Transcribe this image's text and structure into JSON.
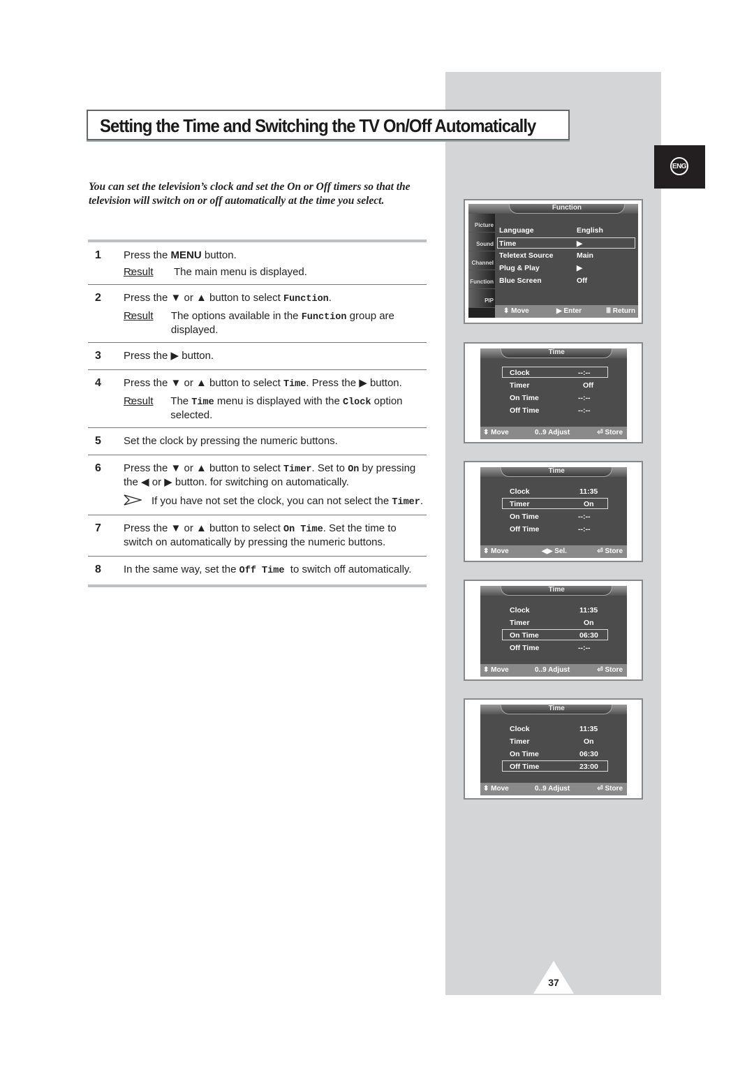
{
  "header": {
    "title": "Setting the Time and Switching the TV On/Off Automatically",
    "language_badge": "ENG"
  },
  "intro": "You can set the television’s clock and set the On or Off timers so that the television will switch on or off automatically at the time you select.",
  "steps": [
    {
      "num": "1",
      "parts": [
        "Press the ",
        "MENU",
        " button."
      ],
      "result_label": "Result",
      "result": "The main menu is displayed."
    },
    {
      "num": "2",
      "parts": [
        "Press the ▼ or ▲ button to select ",
        "Function",
        "."
      ],
      "result_label": "Result",
      "result_parts": [
        "The options available in the ",
        "Function",
        " group are displayed."
      ]
    },
    {
      "num": "3",
      "text": "Press the ▶ button."
    },
    {
      "num": "4",
      "parts": [
        "Press the ▼ or ▲ button to select ",
        "Time",
        ". Press the ▶ button."
      ],
      "result_label": "Result",
      "result_parts": [
        "The ",
        "Time",
        " menu is displayed with the ",
        "Clock",
        " option selected."
      ]
    },
    {
      "num": "5",
      "text": "Set the clock by pressing the numeric buttons."
    },
    {
      "num": "6",
      "parts": [
        "Press the ▼ or ▲ button to select ",
        "Timer",
        ". Set to ",
        "On",
        " by pressing the ◀ or ▶ button. for switching on automatically."
      ],
      "note_parts": [
        "If you have not set the clock, you can not select the ",
        "Timer",
        "."
      ]
    },
    {
      "num": "7",
      "parts": [
        "Press the ▼ or ▲ button to select ",
        "On Time",
        ". Set the time to switch on automatically by pressing the numeric buttons."
      ]
    },
    {
      "num": "8",
      "parts": [
        "In the same way, set the ",
        "Off Time",
        "  to switch off automatically."
      ]
    }
  ],
  "screens": {
    "function_menu": {
      "title": "Function",
      "side_tabs": [
        "Picture",
        "Sound",
        "Channel",
        "Function",
        "PIP"
      ],
      "rows": [
        {
          "label": "Language",
          "value": "English"
        },
        {
          "label": "Time",
          "value": "▶",
          "selected": true
        },
        {
          "label": "Teletext Source",
          "value": "Main"
        },
        {
          "label": "Plug & Play",
          "value": "▶"
        },
        {
          "label": "Blue Screen",
          "value": "Off"
        }
      ],
      "footer": {
        "move": "⬍ Move",
        "enter": "▶ Enter",
        "return": "Ⅲ Return"
      }
    },
    "time_1": {
      "title": "Time",
      "rows": [
        {
          "label": "Clock",
          "value": "--:--",
          "selected": true
        },
        {
          "label": "Timer",
          "value": "Off"
        },
        {
          "label": "On Time",
          "value": "--:--"
        },
        {
          "label": "Off Time",
          "value": "--:--"
        }
      ],
      "footer": {
        "move": "⬍ Move",
        "mid": "0..9 Adjust",
        "store": "⏎ Store"
      }
    },
    "time_2": {
      "title": "Time",
      "rows": [
        {
          "label": "Clock",
          "value": "11:35"
        },
        {
          "label": "Timer",
          "value": "On",
          "selected": true
        },
        {
          "label": "On Time",
          "value": "--:--"
        },
        {
          "label": "Off Time",
          "value": "--:--"
        }
      ],
      "footer": {
        "move": "⬍ Move",
        "mid": "◀▶ Sel.",
        "store": "⏎ Store"
      }
    },
    "time_3": {
      "title": "Time",
      "rows": [
        {
          "label": "Clock",
          "value": "11:35"
        },
        {
          "label": "Timer",
          "value": "On"
        },
        {
          "label": "On Time",
          "value": "06:30",
          "selected": true
        },
        {
          "label": "Off Time",
          "value": "--:--"
        }
      ],
      "footer": {
        "move": "⬍ Move",
        "mid": "0..9 Adjust",
        "store": "⏎ Store"
      }
    },
    "time_4": {
      "title": "Time",
      "rows": [
        {
          "label": "Clock",
          "value": "11:35"
        },
        {
          "label": "Timer",
          "value": "On"
        },
        {
          "label": "On Time",
          "value": "06:30"
        },
        {
          "label": "Off Time",
          "value": "23:00",
          "selected": true
        }
      ],
      "footer": {
        "move": "⬍ Move",
        "mid": "0..9 Adjust",
        "store": "⏎ Store"
      }
    }
  },
  "page_number": "37"
}
